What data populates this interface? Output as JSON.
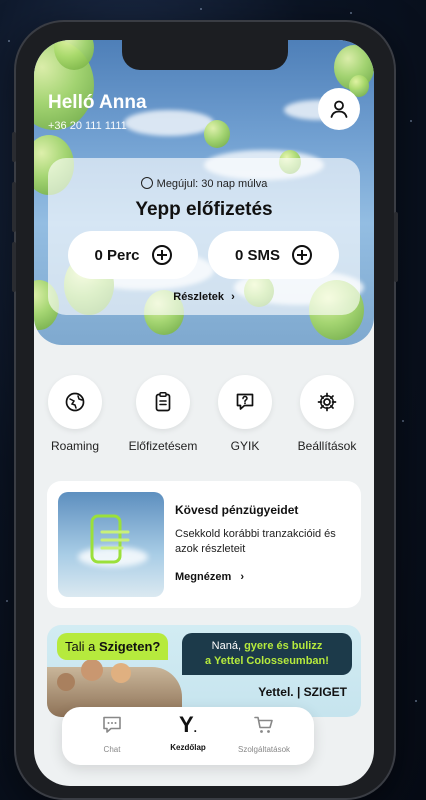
{
  "header": {
    "greeting": "Helló Anna",
    "phone_number": "+36 20 111 1111"
  },
  "plan": {
    "renewal": "Megújul: 30 nap múlva",
    "name": "Yepp előfizetés",
    "minutes": "0 Perc",
    "sms": "0 SMS",
    "details_link": "Részletek"
  },
  "quick_actions": [
    {
      "label": "Roaming",
      "icon": "globe-plane-icon"
    },
    {
      "label": "Előfizetésem",
      "icon": "clipboard-icon"
    },
    {
      "label": "GYIK",
      "icon": "question-bubble-icon"
    },
    {
      "label": "Beállítások",
      "icon": "gear-icon"
    }
  ],
  "promo": {
    "title": "Kövesd pénzügyeidet",
    "text": "Csekkold korábbi tranzakcióid és azok részleteit",
    "link": "Megnézem"
  },
  "banner": {
    "left_prefix": "Tali a ",
    "left_highlight": "Szigeten?",
    "right_line1_a": "Naná, ",
    "right_line1_b": "gyere és bulizz",
    "right_line2": "a Yettel Colosseumban!",
    "logos": "Yettel. | SZIGET"
  },
  "tabs": [
    {
      "label": "Chat",
      "icon": "chat-icon"
    },
    {
      "label": "Kezdőlap",
      "icon": "yettel-y-icon"
    },
    {
      "label": "Szolgáltatások",
      "icon": "cart-icon"
    }
  ],
  "colors": {
    "accent": "#b6ea3d",
    "dark": "#1c3a4a",
    "background": "#eef1f2"
  }
}
